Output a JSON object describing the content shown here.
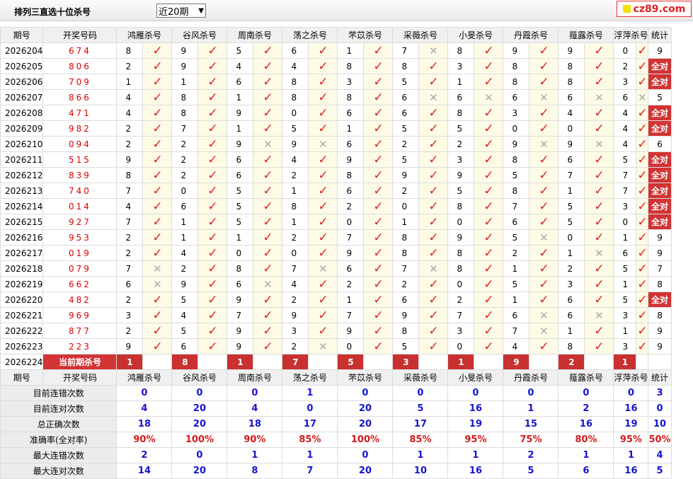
{
  "page": {
    "title": "排列三直选十位杀号",
    "select_value": "近20期",
    "logo_text": "cz89.com"
  },
  "headers": [
    "期号",
    "开奖号码",
    "鸿雁杀号",
    "谷风杀号",
    "周南杀号",
    "荡之杀号",
    "芣苡杀号",
    "采薇杀号",
    "小旻杀号",
    "丹霞杀号",
    "薤露杀号",
    "浮萍杀号",
    "统计"
  ],
  "rows": [
    {
      "period": "2026204",
      "num": "674",
      "kills": [
        [
          "8",
          1
        ],
        [
          "9",
          1
        ],
        [
          "5",
          1
        ],
        [
          "6",
          1
        ],
        [
          "1",
          1
        ],
        [
          "7",
          0
        ],
        [
          "8",
          1
        ],
        [
          "9",
          1
        ],
        [
          "9",
          1
        ],
        [
          "0",
          1
        ]
      ],
      "stat": "9"
    },
    {
      "period": "2026205",
      "num": "806",
      "kills": [
        [
          "2",
          1
        ],
        [
          "9",
          1
        ],
        [
          "4",
          1
        ],
        [
          "4",
          1
        ],
        [
          "8",
          1
        ],
        [
          "8",
          1
        ],
        [
          "3",
          1
        ],
        [
          "8",
          1
        ],
        [
          "8",
          1
        ],
        [
          "2",
          1
        ]
      ],
      "stat": "全对"
    },
    {
      "period": "2026206",
      "num": "709",
      "kills": [
        [
          "1",
          1
        ],
        [
          "1",
          1
        ],
        [
          "6",
          1
        ],
        [
          "8",
          1
        ],
        [
          "3",
          1
        ],
        [
          "5",
          1
        ],
        [
          "1",
          1
        ],
        [
          "8",
          1
        ],
        [
          "8",
          1
        ],
        [
          "3",
          1
        ]
      ],
      "stat": "全对"
    },
    {
      "period": "2026207",
      "num": "866",
      "kills": [
        [
          "4",
          1
        ],
        [
          "8",
          1
        ],
        [
          "1",
          1
        ],
        [
          "8",
          1
        ],
        [
          "8",
          1
        ],
        [
          "6",
          0
        ],
        [
          "6",
          0
        ],
        [
          "6",
          0
        ],
        [
          "6",
          0
        ],
        [
          "6",
          0
        ]
      ],
      "stat": "5"
    },
    {
      "period": "2026208",
      "num": "471",
      "kills": [
        [
          "4",
          1
        ],
        [
          "8",
          1
        ],
        [
          "9",
          1
        ],
        [
          "0",
          1
        ],
        [
          "6",
          1
        ],
        [
          "6",
          1
        ],
        [
          "8",
          1
        ],
        [
          "3",
          1
        ],
        [
          "4",
          1
        ],
        [
          "4",
          1
        ]
      ],
      "stat": "全对"
    },
    {
      "period": "2026209",
      "num": "982",
      "kills": [
        [
          "2",
          1
        ],
        [
          "7",
          1
        ],
        [
          "1",
          1
        ],
        [
          "5",
          1
        ],
        [
          "1",
          1
        ],
        [
          "5",
          1
        ],
        [
          "5",
          1
        ],
        [
          "0",
          1
        ],
        [
          "0",
          1
        ],
        [
          "4",
          1
        ]
      ],
      "stat": "全对"
    },
    {
      "period": "2026210",
      "num": "094",
      "kills": [
        [
          "2",
          1
        ],
        [
          "2",
          1
        ],
        [
          "9",
          0
        ],
        [
          "9",
          0
        ],
        [
          "6",
          1
        ],
        [
          "2",
          1
        ],
        [
          "2",
          1
        ],
        [
          "9",
          0
        ],
        [
          "9",
          0
        ],
        [
          "4",
          1
        ]
      ],
      "stat": "6"
    },
    {
      "period": "2026211",
      "num": "515",
      "kills": [
        [
          "9",
          1
        ],
        [
          "2",
          1
        ],
        [
          "6",
          1
        ],
        [
          "4",
          1
        ],
        [
          "9",
          1
        ],
        [
          "5",
          1
        ],
        [
          "3",
          1
        ],
        [
          "8",
          1
        ],
        [
          "6",
          1
        ],
        [
          "5",
          1
        ]
      ],
      "stat": "全对"
    },
    {
      "period": "2026212",
      "num": "839",
      "kills": [
        [
          "8",
          1
        ],
        [
          "2",
          1
        ],
        [
          "6",
          1
        ],
        [
          "2",
          1
        ],
        [
          "8",
          1
        ],
        [
          "9",
          1
        ],
        [
          "9",
          1
        ],
        [
          "5",
          1
        ],
        [
          "7",
          1
        ],
        [
          "7",
          1
        ]
      ],
      "stat": "全对"
    },
    {
      "period": "2026213",
      "num": "740",
      "kills": [
        [
          "7",
          1
        ],
        [
          "0",
          1
        ],
        [
          "5",
          1
        ],
        [
          "1",
          1
        ],
        [
          "6",
          1
        ],
        [
          "2",
          1
        ],
        [
          "5",
          1
        ],
        [
          "8",
          1
        ],
        [
          "1",
          1
        ],
        [
          "7",
          1
        ]
      ],
      "stat": "全对"
    },
    {
      "period": "2026214",
      "num": "014",
      "kills": [
        [
          "4",
          1
        ],
        [
          "6",
          1
        ],
        [
          "5",
          1
        ],
        [
          "8",
          1
        ],
        [
          "2",
          1
        ],
        [
          "0",
          1
        ],
        [
          "8",
          1
        ],
        [
          "7",
          1
        ],
        [
          "5",
          1
        ],
        [
          "3",
          1
        ]
      ],
      "stat": "全对"
    },
    {
      "period": "2026215",
      "num": "927",
      "kills": [
        [
          "7",
          1
        ],
        [
          "1",
          1
        ],
        [
          "5",
          1
        ],
        [
          "1",
          1
        ],
        [
          "0",
          1
        ],
        [
          "1",
          1
        ],
        [
          "0",
          1
        ],
        [
          "6",
          1
        ],
        [
          "5",
          1
        ],
        [
          "0",
          1
        ]
      ],
      "stat": "全对"
    },
    {
      "period": "2026216",
      "num": "953",
      "kills": [
        [
          "2",
          1
        ],
        [
          "1",
          1
        ],
        [
          "1",
          1
        ],
        [
          "2",
          1
        ],
        [
          "7",
          1
        ],
        [
          "8",
          1
        ],
        [
          "9",
          1
        ],
        [
          "5",
          0
        ],
        [
          "0",
          1
        ],
        [
          "1",
          1
        ]
      ],
      "stat": "9"
    },
    {
      "period": "2026217",
      "num": "019",
      "kills": [
        [
          "2",
          1
        ],
        [
          "4",
          1
        ],
        [
          "0",
          1
        ],
        [
          "0",
          1
        ],
        [
          "9",
          1
        ],
        [
          "8",
          1
        ],
        [
          "8",
          1
        ],
        [
          "2",
          1
        ],
        [
          "1",
          0
        ],
        [
          "6",
          1
        ]
      ],
      "stat": "9"
    },
    {
      "period": "2026218",
      "num": "079",
      "kills": [
        [
          "7",
          0
        ],
        [
          "2",
          1
        ],
        [
          "8",
          1
        ],
        [
          "7",
          0
        ],
        [
          "6",
          1
        ],
        [
          "7",
          0
        ],
        [
          "8",
          1
        ],
        [
          "1",
          1
        ],
        [
          "2",
          1
        ],
        [
          "5",
          1
        ]
      ],
      "stat": "7"
    },
    {
      "period": "2026219",
      "num": "662",
      "kills": [
        [
          "6",
          0
        ],
        [
          "9",
          1
        ],
        [
          "6",
          0
        ],
        [
          "4",
          1
        ],
        [
          "2",
          1
        ],
        [
          "2",
          1
        ],
        [
          "0",
          1
        ],
        [
          "5",
          1
        ],
        [
          "3",
          1
        ],
        [
          "1",
          1
        ]
      ],
      "stat": "8"
    },
    {
      "period": "2026220",
      "num": "482",
      "kills": [
        [
          "2",
          1
        ],
        [
          "5",
          1
        ],
        [
          "9",
          1
        ],
        [
          "2",
          1
        ],
        [
          "1",
          1
        ],
        [
          "6",
          1
        ],
        [
          "2",
          1
        ],
        [
          "1",
          1
        ],
        [
          "6",
          1
        ],
        [
          "5",
          1
        ]
      ],
      "stat": "全对"
    },
    {
      "period": "2026221",
      "num": "969",
      "kills": [
        [
          "3",
          1
        ],
        [
          "4",
          1
        ],
        [
          "7",
          1
        ],
        [
          "9",
          1
        ],
        [
          "7",
          1
        ],
        [
          "9",
          1
        ],
        [
          "7",
          1
        ],
        [
          "6",
          0
        ],
        [
          "6",
          0
        ],
        [
          "3",
          1
        ]
      ],
      "stat": "8"
    },
    {
      "period": "2026222",
      "num": "877",
      "kills": [
        [
          "2",
          1
        ],
        [
          "5",
          1
        ],
        [
          "9",
          1
        ],
        [
          "3",
          1
        ],
        [
          "9",
          1
        ],
        [
          "8",
          1
        ],
        [
          "3",
          1
        ],
        [
          "7",
          0
        ],
        [
          "1",
          1
        ],
        [
          "1",
          1
        ]
      ],
      "stat": "9"
    },
    {
      "period": "2026223",
      "num": "223",
      "kills": [
        [
          "9",
          1
        ],
        [
          "6",
          1
        ],
        [
          "9",
          1
        ],
        [
          "2",
          0
        ],
        [
          "0",
          1
        ],
        [
          "5",
          1
        ],
        [
          "0",
          1
        ],
        [
          "4",
          1
        ],
        [
          "8",
          1
        ],
        [
          "3",
          1
        ]
      ],
      "stat": "9"
    }
  ],
  "current": {
    "period": "2026224",
    "label": "当前期杀号",
    "kills": [
      "1",
      "8",
      "1",
      "7",
      "5",
      "3",
      "1",
      "9",
      "2",
      "1"
    ]
  },
  "stats": [
    {
      "label": "目前连错次数",
      "values": [
        "0",
        "0",
        "0",
        "1",
        "0",
        "0",
        "0",
        "0",
        "0",
        "0",
        "3"
      ],
      "red": false
    },
    {
      "label": "目前连对次数",
      "values": [
        "4",
        "20",
        "4",
        "0",
        "20",
        "5",
        "16",
        "1",
        "2",
        "16",
        "0"
      ],
      "red": false
    },
    {
      "label": "总正确次数",
      "values": [
        "18",
        "20",
        "18",
        "17",
        "20",
        "17",
        "19",
        "15",
        "16",
        "19",
        "10"
      ],
      "red": false
    },
    {
      "label": "准确率(全对率)",
      "values": [
        "90%",
        "100%",
        "90%",
        "85%",
        "100%",
        "85%",
        "95%",
        "75%",
        "80%",
        "95%",
        "50%"
      ],
      "red": true
    },
    {
      "label": "最大连错次数",
      "values": [
        "2",
        "0",
        "1",
        "1",
        "0",
        "1",
        "1",
        "2",
        "1",
        "1",
        "4"
      ],
      "red": false
    },
    {
      "label": "最大连对次数",
      "values": [
        "14",
        "20",
        "8",
        "7",
        "20",
        "10",
        "16",
        "5",
        "6",
        "16",
        "5"
      ],
      "red": false
    }
  ]
}
